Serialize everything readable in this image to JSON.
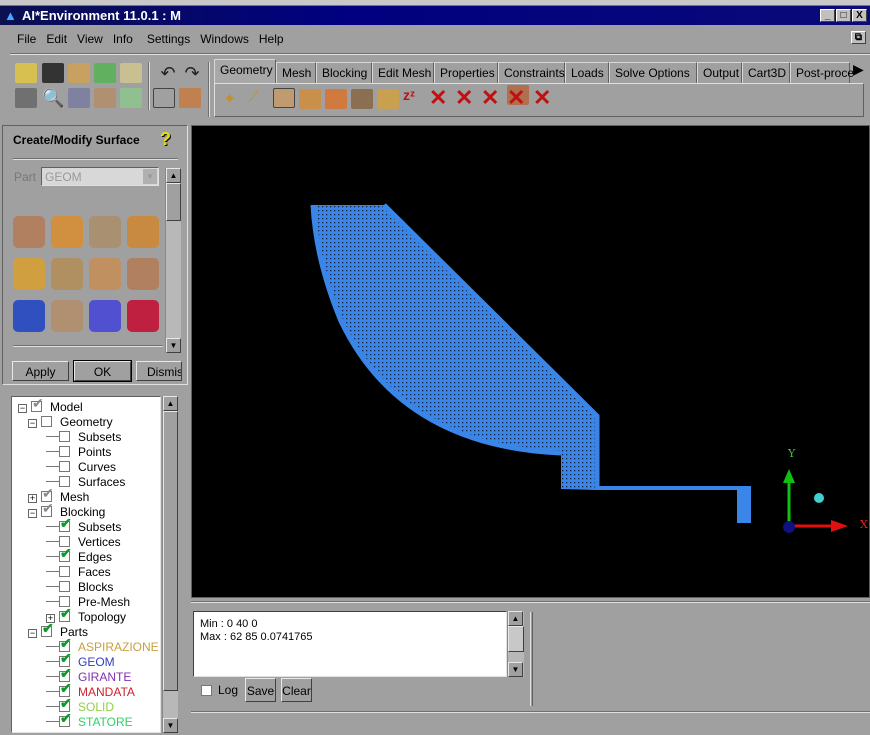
{
  "window": {
    "title": "AI*Environment 11.0.1 : M",
    "minimize": "_",
    "maximize": "□",
    "close": "X",
    "restore": "⧉"
  },
  "menu": [
    "File",
    "Edit",
    "View",
    "Info",
    "Settings",
    "Windows",
    "Help"
  ],
  "tabs": [
    "Geometry",
    "Mesh",
    "Blocking",
    "Edit Mesh",
    "Properties",
    "Constraints",
    "Loads",
    "Solve Options",
    "Output",
    "Cart3D",
    "Post-proce"
  ],
  "active_tab": "Geometry",
  "panel": {
    "title": "Create/Modify Surface",
    "help": "?",
    "part_label": "Part",
    "part_value": "GEOM",
    "apply": "Apply",
    "ok": "OK",
    "dismiss": "Dismis"
  },
  "tree": [
    {
      "label": "Model",
      "level": 0,
      "expander": "-",
      "check": "gray"
    },
    {
      "label": "Geometry",
      "level": 1,
      "expander": "-",
      "check": "off"
    },
    {
      "label": "Subsets",
      "level": 2,
      "check": "off"
    },
    {
      "label": "Points",
      "level": 2,
      "check": "off"
    },
    {
      "label": "Curves",
      "level": 2,
      "check": "off"
    },
    {
      "label": "Surfaces",
      "level": 2,
      "check": "off"
    },
    {
      "label": "Mesh",
      "level": 1,
      "expander": "+",
      "check": "gray"
    },
    {
      "label": "Blocking",
      "level": 1,
      "expander": "-",
      "check": "gray"
    },
    {
      "label": "Subsets",
      "level": 2,
      "check": "on"
    },
    {
      "label": "Vertices",
      "level": 2,
      "check": "off"
    },
    {
      "label": "Edges",
      "level": 2,
      "check": "on"
    },
    {
      "label": "Faces",
      "level": 2,
      "check": "off"
    },
    {
      "label": "Blocks",
      "level": 2,
      "check": "off"
    },
    {
      "label": "Pre-Mesh",
      "level": 2,
      "check": "off"
    },
    {
      "label": "Topology",
      "level": 2,
      "expander": "+",
      "check": "on"
    },
    {
      "label": "Parts",
      "level": 1,
      "expander": "-",
      "check": "on"
    },
    {
      "label": "ASPIRAZIONE",
      "level": 2,
      "check": "on",
      "color": "#c8a040"
    },
    {
      "label": "GEOM",
      "level": 2,
      "check": "on",
      "color": "#3040c0"
    },
    {
      "label": "GIRANTE",
      "level": 2,
      "check": "on",
      "color": "#8030b0"
    },
    {
      "label": "MANDATA",
      "level": 2,
      "check": "on",
      "color": "#d02030"
    },
    {
      "label": "SOLID",
      "level": 2,
      "check": "on",
      "color": "#90d040"
    },
    {
      "label": "STATORE",
      "level": 2,
      "check": "on",
      "color": "#30d060"
    }
  ],
  "messages": {
    "lines": [
      "Min : 0 40 0",
      "Max : 62 85 0.0741765"
    ],
    "log_label": "Log",
    "log_checked": false,
    "save": "Save",
    "clear": "Clear"
  },
  "viewport": {
    "background": "#000000",
    "mesh_color": "#3a86e8",
    "axis_x": "X",
    "axis_y": "Y"
  }
}
